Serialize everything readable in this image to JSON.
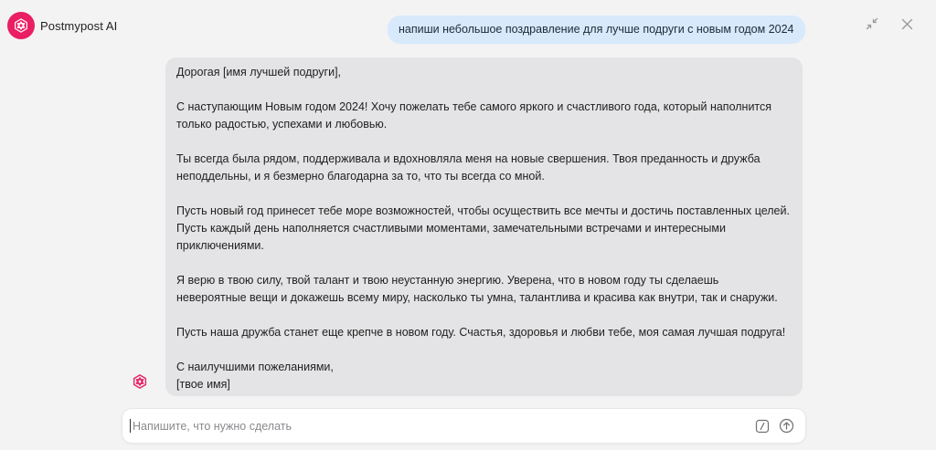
{
  "app": {
    "name": "Postmypost AI",
    "logo_icon": "postmypost-logo-icon",
    "accent": "#e91e63"
  },
  "window_controls": {
    "minimize_icon": "collapse-arrows-icon",
    "close_icon": "close-icon"
  },
  "conversation": {
    "user_message": "напиши небольшое поздравление для лучше подруги с новым годом 2024",
    "assistant_message": {
      "greeting": "Дорогая [имя лучшей подруги],",
      "paragraphs": [
        "С наступающим Новым годом 2024! Хочу пожелать тебе самого яркого и счастливого года, который наполнится только радостью, успехами и любовью.",
        "Ты всегда была рядом, поддерживала и вдохновляла меня на новые свершения. Твоя преданность и дружба неподдельны, и я безмерно благодарна за то, что ты всегда со мной.",
        "Пусть новый год принесет тебе море возможностей, чтобы осуществить все мечты и достичь поставленных целей. Пусть каждый день наполняется счастливыми моментами, замечательными встречами и интересными приключениями.",
        "Я верю в твою силу, твой талант и твою неустанную энергию. Уверена, что в новом году ты сделаешь невероятные вещи и докажешь всему миру, насколько ты умна, талантлива и красива как внутри, так и снаружи.",
        "Пусть наша дружба станет еще крепче в новом году. Счастья, здоровья и любви тебе, моя самая лучшая подруга!"
      ],
      "closing_line": "С наилучшими пожеланиями,",
      "signature": "[твое имя]"
    }
  },
  "composer": {
    "placeholder": "Напишите, что нужно сделать",
    "value": "",
    "command_icon": "slash-command-icon",
    "send_icon": "send-arrow-up-icon"
  }
}
